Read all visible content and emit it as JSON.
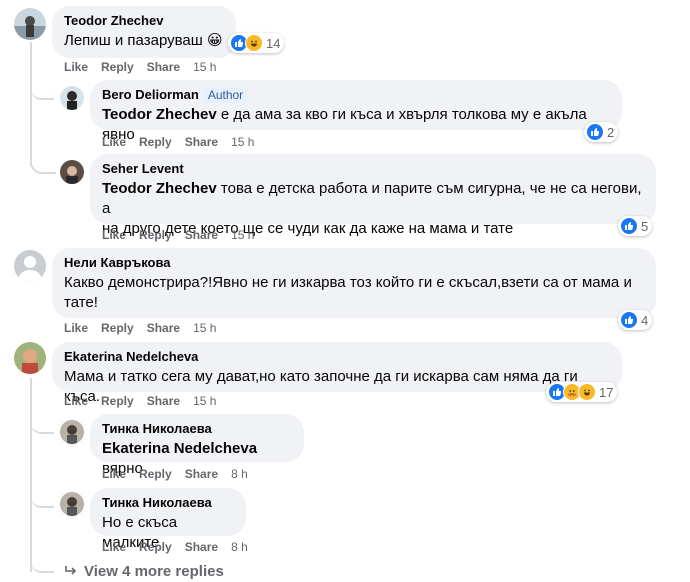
{
  "comments": [
    {
      "author": "Teodor Zhechev",
      "text": "Лепиш и пазаруваш 😀",
      "count": "14",
      "actions": {
        "like": "Like",
        "reply": "Reply",
        "share": "Share",
        "time": "15 h"
      }
    },
    {
      "author": "Bero Deliorman",
      "badge": "Author",
      "mention": "Teodor Zhechev",
      "text": " е да ама за кво ги къса и хвърля толкова му е акъла явно",
      "count": "2",
      "actions": {
        "like": "Like",
        "reply": "Reply",
        "share": "Share",
        "time": "15 h"
      }
    },
    {
      "author": "Seher Levent",
      "mention": "Teodor Zhechev",
      "text_line1": " това е детска работа и парите съм сигурна, че не са негови, а",
      "text_line2": "на друго дете което ще се чуди как да каже на мама и тате",
      "count": "5",
      "actions": {
        "like": "Like",
        "reply": "Reply",
        "share": "Share",
        "time": "15 h"
      }
    },
    {
      "author": "Нели Кавръкова",
      "text_line1": "Какво демонстрира?!Явно не ги изкарва тоз който ги е скъсал,взети са от мама и",
      "text_line2": "тате!",
      "count": "4",
      "actions": {
        "like": "Like",
        "reply": "Reply",
        "share": "Share",
        "time": "15 h"
      }
    },
    {
      "author": "Ekaterina Nedelcheva",
      "text": "Мама и татко сега му дават,но като започне да ги искарва сам няма да ги къса.",
      "count": "17",
      "actions": {
        "like": "Like",
        "reply": "Reply",
        "share": "Share",
        "time": "15 h"
      }
    },
    {
      "author": "Тинка Николаева",
      "mention": "Ekaterina Nedelcheva",
      "text": " вярно",
      "actions": {
        "like": "Like",
        "reply": "Reply",
        "share": "Share",
        "time": "8 h"
      }
    },
    {
      "author": "Тинка Николаева",
      "text": "Но е скъса малките",
      "actions": {
        "like": "Like",
        "reply": "Reply",
        "share": "Share",
        "time": "8 h"
      }
    }
  ],
  "view_more": "View 4 more replies",
  "colors": {
    "bubble": "#f0f2f5",
    "like_blue": "#1877f2",
    "muted": "#65676b"
  }
}
